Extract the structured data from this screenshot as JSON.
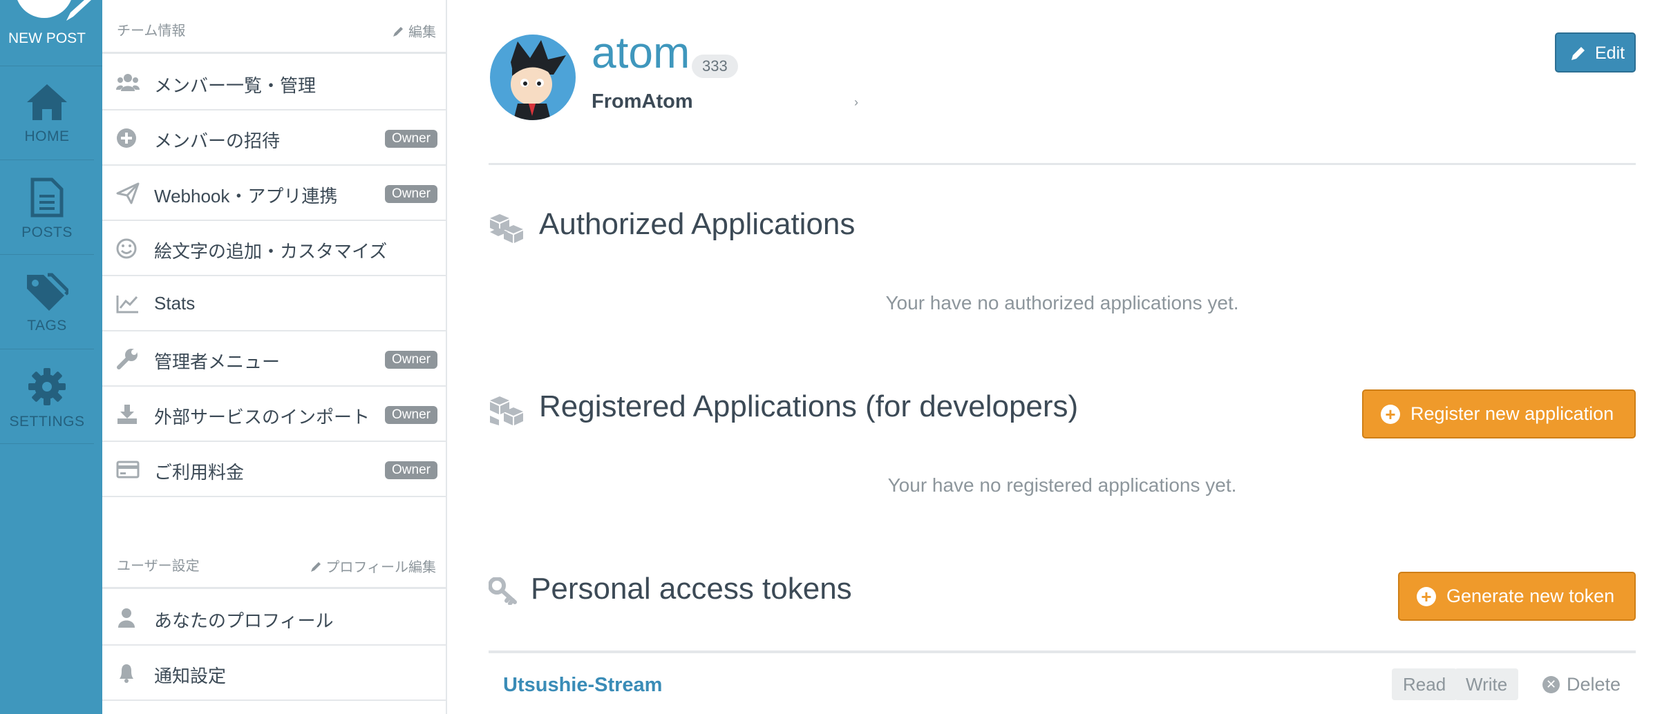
{
  "leftnav": {
    "new_post": "NEW POST",
    "items": [
      {
        "label": "HOME",
        "icon": "home-icon"
      },
      {
        "label": "POSTS",
        "icon": "document-icon"
      },
      {
        "label": "TAGS",
        "icon": "tags-icon"
      },
      {
        "label": "SETTINGS",
        "icon": "gear-icon"
      }
    ]
  },
  "sidebar": {
    "team_section": {
      "title": "チーム情報",
      "edit_link": "編集"
    },
    "team_items": [
      {
        "label": "メンバー一覧・管理",
        "icon": "users-icon",
        "badge": ""
      },
      {
        "label": "メンバーの招待",
        "icon": "plus-circle-icon",
        "badge": "Owner"
      },
      {
        "label": "Webhook・アプリ連携",
        "icon": "paper-plane-icon",
        "badge": "Owner"
      },
      {
        "label": "絵文字の追加・カスタマイズ",
        "icon": "smiley-icon",
        "badge": ""
      },
      {
        "label": "Stats",
        "icon": "chart-icon",
        "badge": ""
      },
      {
        "label": "管理者メニュー",
        "icon": "wrench-icon",
        "badge": "Owner"
      },
      {
        "label": "外部サービスのインポート",
        "icon": "download-icon",
        "badge": "Owner"
      },
      {
        "label": "ご利用料金",
        "icon": "credit-card-icon",
        "badge": "Owner"
      }
    ],
    "user_section": {
      "title": "ユーザー設定",
      "edit_link": "プロフィール編集"
    },
    "user_items": [
      {
        "label": "あなたのプロフィール",
        "icon": "user-icon"
      },
      {
        "label": "通知設定",
        "icon": "bell-icon"
      }
    ]
  },
  "profile": {
    "username": "atom",
    "post_count": "333",
    "screen_name": "FromAtom",
    "edit_button": "Edit"
  },
  "authorized_apps": {
    "title": "Authorized Applications",
    "empty": "Your have no authorized applications yet."
  },
  "registered_apps": {
    "title": "Registered Applications (for developers)",
    "button": "Register new application",
    "empty": "Your have no registered applications yet."
  },
  "tokens": {
    "title": "Personal access tokens",
    "button": "Generate new token",
    "items": [
      {
        "name": "Utsushie-Stream",
        "scopes": [
          "Read",
          "Write"
        ],
        "delete": "Delete"
      }
    ]
  },
  "colors": {
    "nav_bg": "#3f97bd",
    "accent_blue": "#3a8cb7",
    "accent_orange": "#ef9a2b"
  }
}
